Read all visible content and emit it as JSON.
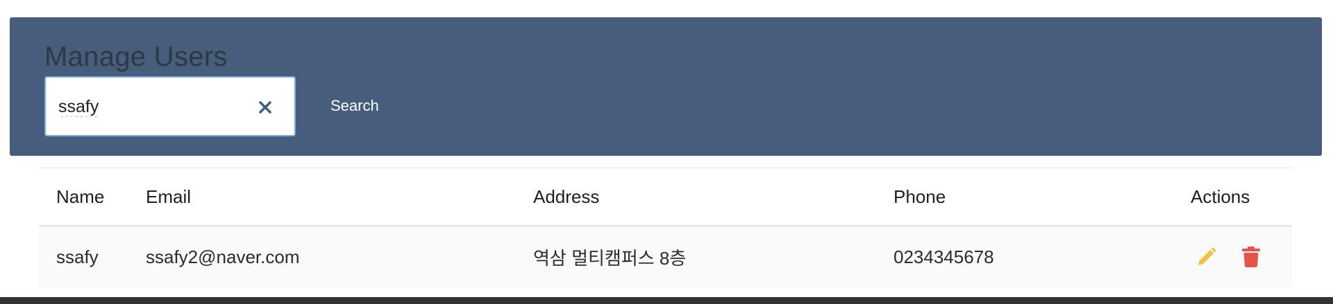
{
  "header": {
    "title": "Manage Users",
    "search": {
      "value": "ssafy",
      "placeholder": ""
    },
    "search_button": "Search"
  },
  "table": {
    "columns": {
      "name": "Name",
      "email": "Email",
      "address": "Address",
      "phone": "Phone",
      "actions": "Actions"
    },
    "rows": [
      {
        "name": "ssafy",
        "email": "ssafy2@naver.com",
        "address": "역삼 멀티캠퍼스 8층",
        "phone": "0234345678",
        "actions": [
          "edit-icon",
          "delete-icon"
        ]
      }
    ]
  },
  "colors": {
    "header_bg": "#465e7c",
    "edit_icon": "#f5c142",
    "delete_icon": "#e5534b",
    "clear_icon": "#3b5a86"
  }
}
